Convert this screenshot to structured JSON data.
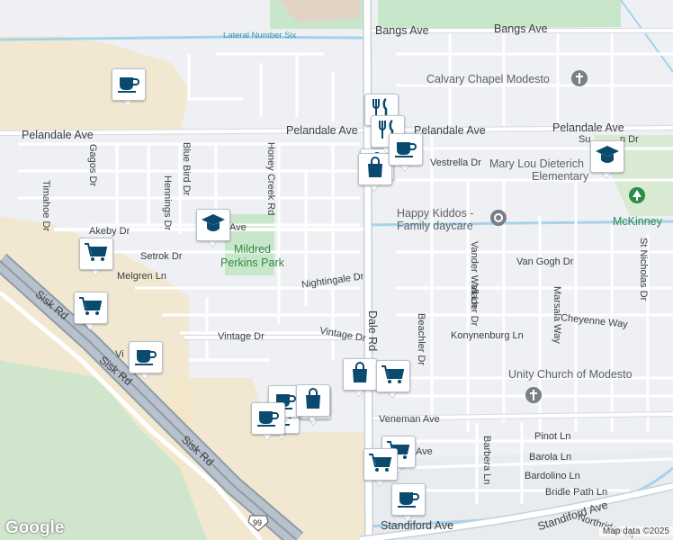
{
  "map": {
    "attribution": "Map data ©2025",
    "logo": "Google"
  },
  "colors": {
    "background": "#eef0f3",
    "street": "#ffffff",
    "arterial": "#d6dbe2",
    "highway": "#a8b3c0",
    "park": "#c8e6c9",
    "commercial": "#f3e6c8",
    "water": "#a5d4ea",
    "marker_icon": "#0b4a6f"
  },
  "labels": {
    "lateral": "Lateral Number Six",
    "bangs": "Bangs Ave",
    "calvary": "Calvary Chapel Modesto",
    "pelandale_w": "Pelandale Ave",
    "pelandale_m": "Pelandale Ave",
    "pelandale_e": "Pelandale Ave",
    "sun": "Su",
    "sun_dr": "n Dr",
    "vestrella": "Vestrella Dr",
    "marylou1": "Mary Lou Dieterich",
    "marylou2": "Elementary",
    "gagos": "Gagos Dr",
    "bluebird": "Blue Bird Dr",
    "hennings": "Hennings Dr",
    "honeycreek": "Honey Creek Rd",
    "timahoe": "Timahoe Dr",
    "akeby": "Akeby Dr",
    "ave_frag": "Ave",
    "happy": "Happy Kiddos -",
    "family": "Family daycare",
    "mckinney": "McKinney",
    "mildred1": "Mildred",
    "mildred2": "Perkins Park",
    "setrok": "Setrok Dr",
    "melgren": "Melgren Ln",
    "vangogh": "Van Gogh Dr",
    "vanderwall": "Vander Wall Ln",
    "stnicholas": "St Nicholas Dr",
    "viader": "Viader Dr",
    "marsala": "Marsala Way",
    "cheyenne": "Cheyenne Way",
    "nightingale": "Nightingale Dr",
    "dale": "Dale Rd",
    "beachler": "Beachler Dr",
    "sisk1": "Sisk Rd",
    "sisk2": "Sisk Rd",
    "sisk3": "Sisk Rd",
    "vintage1": "Vintage Dr",
    "vintage2": "Vintage Dr",
    "vi_frag": "Vi",
    "konynenburg": "Konynenburg Ln",
    "unity": "Unity Church of Modesto",
    "veneman": "Veneman Ave",
    "pinot": "Pinot Ln",
    "barola": "Barola Ln",
    "bardolino": "Bardolino Ln",
    "barbera": "Barbera Ln",
    "bridle": "Bridle Path Ln",
    "standiford1": "Standiford Ave",
    "standiford2": "Standiford Ave",
    "northridge": "Northridge Dr",
    "hwy99": "99",
    "ave_frag2": "Ave"
  },
  "markers": [
    {
      "icon": "coffee"
    },
    {
      "icon": "food"
    },
    {
      "icon": "shopping"
    },
    {
      "icon": "shopping"
    },
    {
      "icon": "food"
    },
    {
      "icon": "coffee"
    },
    {
      "icon": "school"
    },
    {
      "icon": "school"
    },
    {
      "icon": "cart"
    },
    {
      "icon": "cart"
    },
    {
      "icon": "coffee"
    },
    {
      "icon": "shopping"
    },
    {
      "icon": "cart"
    },
    {
      "icon": "cart"
    },
    {
      "icon": "cart"
    },
    {
      "icon": "shopping"
    },
    {
      "icon": "coffee"
    },
    {
      "icon": "coffee"
    },
    {
      "icon": "coffee"
    },
    {
      "icon": "shopping"
    },
    {
      "icon": "coffee"
    }
  ]
}
